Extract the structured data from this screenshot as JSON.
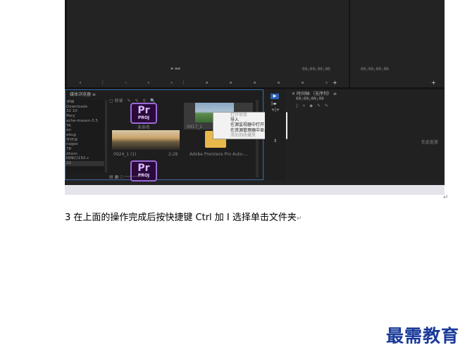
{
  "screenshot": {
    "timecode_left": "00;00;00;00",
    "timecode_right": "00;00;00;00",
    "timecode_timeline": "00;00;00;00",
    "project_panel_title": "媒体浏览器",
    "project_search_label": "收录",
    "timeline_title": "时间轴:（无序列）",
    "timeline_hint": "在此处放",
    "tree_items": [
      "详细",
      "Downloads",
      "32 10",
      "ffery",
      "ache-maven-3.5",
      "TA",
      "en",
      "ebug",
      "件作业",
      "nages",
      "78",
      "dhom",
      "网络(\\\\192.c",
      "22"
    ],
    "project_items": [
      {
        "label": "未命名",
        "type": "prproj"
      },
      {
        "label": "0917_1",
        "type": "video"
      },
      {
        "label": "0924_1 (1)",
        "type": "video",
        "duration": "2;28"
      },
      {
        "label": "Adobe Premiere Pro Auto-...",
        "type": "folder"
      },
      {
        "label": "",
        "type": "prproj"
      }
    ],
    "pr_icon_text": "Pr",
    "pr_icon_sub": "PROJ",
    "context_menu": [
      {
        "label": "打开项目",
        "disabled": true
      },
      {
        "label": "导入",
        "disabled": false
      },
      {
        "label": "在源监视器中打开",
        "disabled": false
      },
      {
        "label": "在资源管理器中显示",
        "disabled": false
      },
      {
        "label": "添加到收藏夹",
        "disabled": true
      }
    ]
  },
  "caption": "3 在上面的操作完成后按快捷键 Ctrl 加 I 选择单击文件夹",
  "return_mark": "↵",
  "logo_text": "最需教育",
  "colors": {
    "panel": "#232323",
    "accent_blue": "#3a6ea8",
    "logo": "#1a3a9a"
  }
}
